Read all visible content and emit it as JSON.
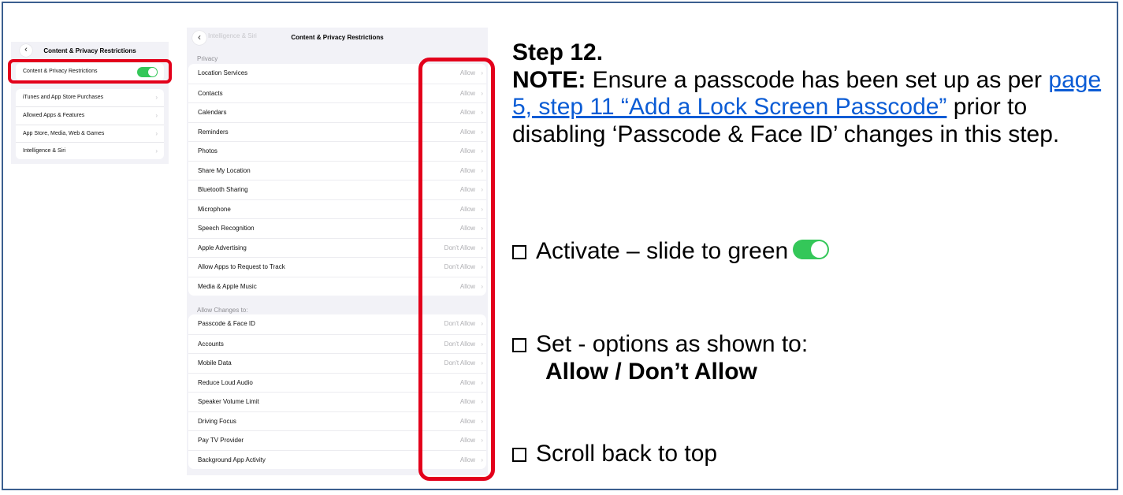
{
  "screenshot_small": {
    "title": "Content & Privacy Restrictions",
    "toggle_label": "Content & Privacy Restrictions",
    "toggle_on": true,
    "items": [
      {
        "label": "iTunes and App Store Purchases"
      },
      {
        "label": "Allowed Apps & Features"
      },
      {
        "label": "App Store, Media, Web & Games"
      },
      {
        "label": "Intelligence & Siri"
      }
    ]
  },
  "screenshot_large": {
    "back_label": "Intelligence & Siri",
    "title": "Content & Privacy Restrictions",
    "privacy_header": "Privacy",
    "privacy_items": [
      {
        "label": "Location Services",
        "value": "Allow"
      },
      {
        "label": "Contacts",
        "value": "Allow"
      },
      {
        "label": "Calendars",
        "value": "Allow"
      },
      {
        "label": "Reminders",
        "value": "Allow"
      },
      {
        "label": "Photos",
        "value": "Allow"
      },
      {
        "label": "Share My Location",
        "value": "Allow"
      },
      {
        "label": "Bluetooth Sharing",
        "value": "Allow"
      },
      {
        "label": "Microphone",
        "value": "Allow"
      },
      {
        "label": "Speech Recognition",
        "value": "Allow"
      },
      {
        "label": "Apple Advertising",
        "value": "Don't Allow"
      },
      {
        "label": "Allow Apps to Request to Track",
        "value": "Don't Allow"
      },
      {
        "label": "Media & Apple Music",
        "value": "Allow"
      }
    ],
    "changes_header": "Allow Changes to:",
    "changes_items": [
      {
        "label": "Passcode & Face ID",
        "value": "Don't Allow"
      },
      {
        "label": "Accounts",
        "value": "Don't Allow"
      },
      {
        "label": "Mobile Data",
        "value": "Don't Allow"
      },
      {
        "label": "Reduce Loud Audio",
        "value": "Allow"
      },
      {
        "label": "Speaker Volume Limit",
        "value": "Allow"
      },
      {
        "label": "Driving Focus",
        "value": "Allow"
      },
      {
        "label": "Pay TV Provider",
        "value": "Allow"
      },
      {
        "label": "Background App Activity",
        "value": "Allow"
      }
    ]
  },
  "instructions": {
    "step": "Step 12.",
    "note_label": "NOTE:",
    "note_text_1": " Ensure a passcode has been set up as per ",
    "note_link": "page 5, step 11 “Add a Lock Screen Passcode”",
    "note_text_2": " prior to disabling ‘Passcode & Face ID’ changes in this step.",
    "bullet_1": "Activate – slide to green",
    "bullet_2": "Set - options as shown to:",
    "bullet_2_sub": "Allow / Don’t Allow",
    "bullet_3": "Scroll back to top"
  },
  "colors": {
    "highlight": "#e3001b",
    "toggle_green": "#34c759",
    "link": "#0b5cd5",
    "frame": "#3b5f8f"
  }
}
